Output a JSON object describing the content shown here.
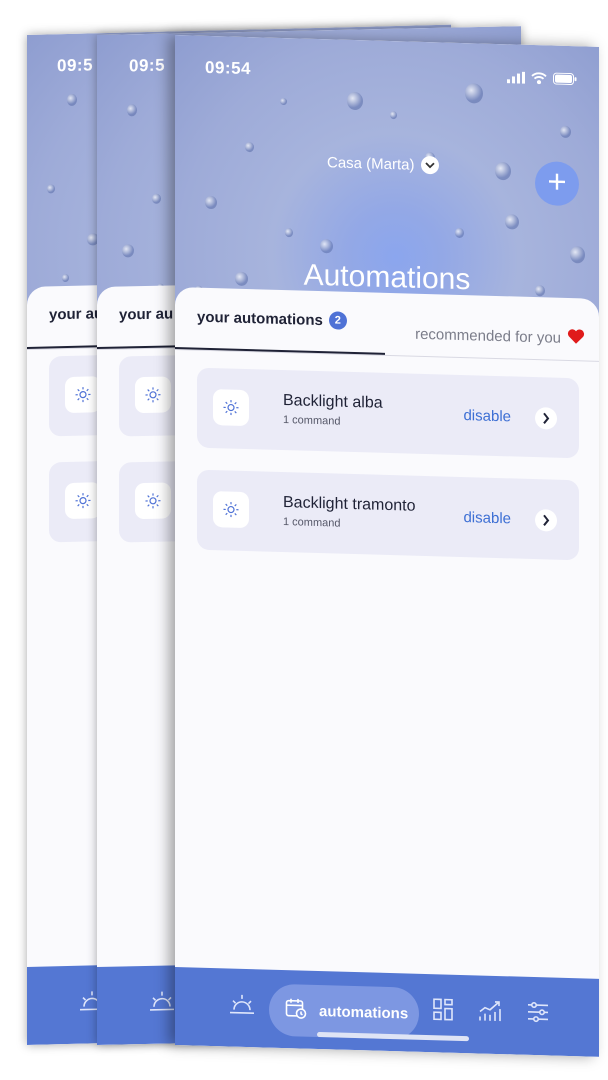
{
  "status_bar": {
    "time": "09:54",
    "back_time": "09:5"
  },
  "header": {
    "home_name": "Casa (Marta)",
    "title": "Automations"
  },
  "tabs": {
    "active_label": "your automations",
    "active_count": "2",
    "other_label": "recommended for you",
    "back_fragment_1": "your au",
    "back_fragment_2": "your au"
  },
  "automations": [
    {
      "name": "Backlight alba",
      "commands": "1 command",
      "action": "disable"
    },
    {
      "name": "Backlight tramonto",
      "commands": "1 command",
      "action": "disable"
    }
  ],
  "navbar": {
    "active_label": "automations"
  },
  "colors": {
    "accent": "#5477d3",
    "link": "#3d6fd4",
    "card": "#ebebf7",
    "heart": "#e01b1b"
  },
  "icons": [
    "sun-icon",
    "chevron-down-icon",
    "plus-icon",
    "heart-icon",
    "chevron-right-icon",
    "sunrise-icon",
    "calendar-clock-icon",
    "dashboard-icon",
    "bar-chart-icon",
    "settings-sliders-icon"
  ]
}
